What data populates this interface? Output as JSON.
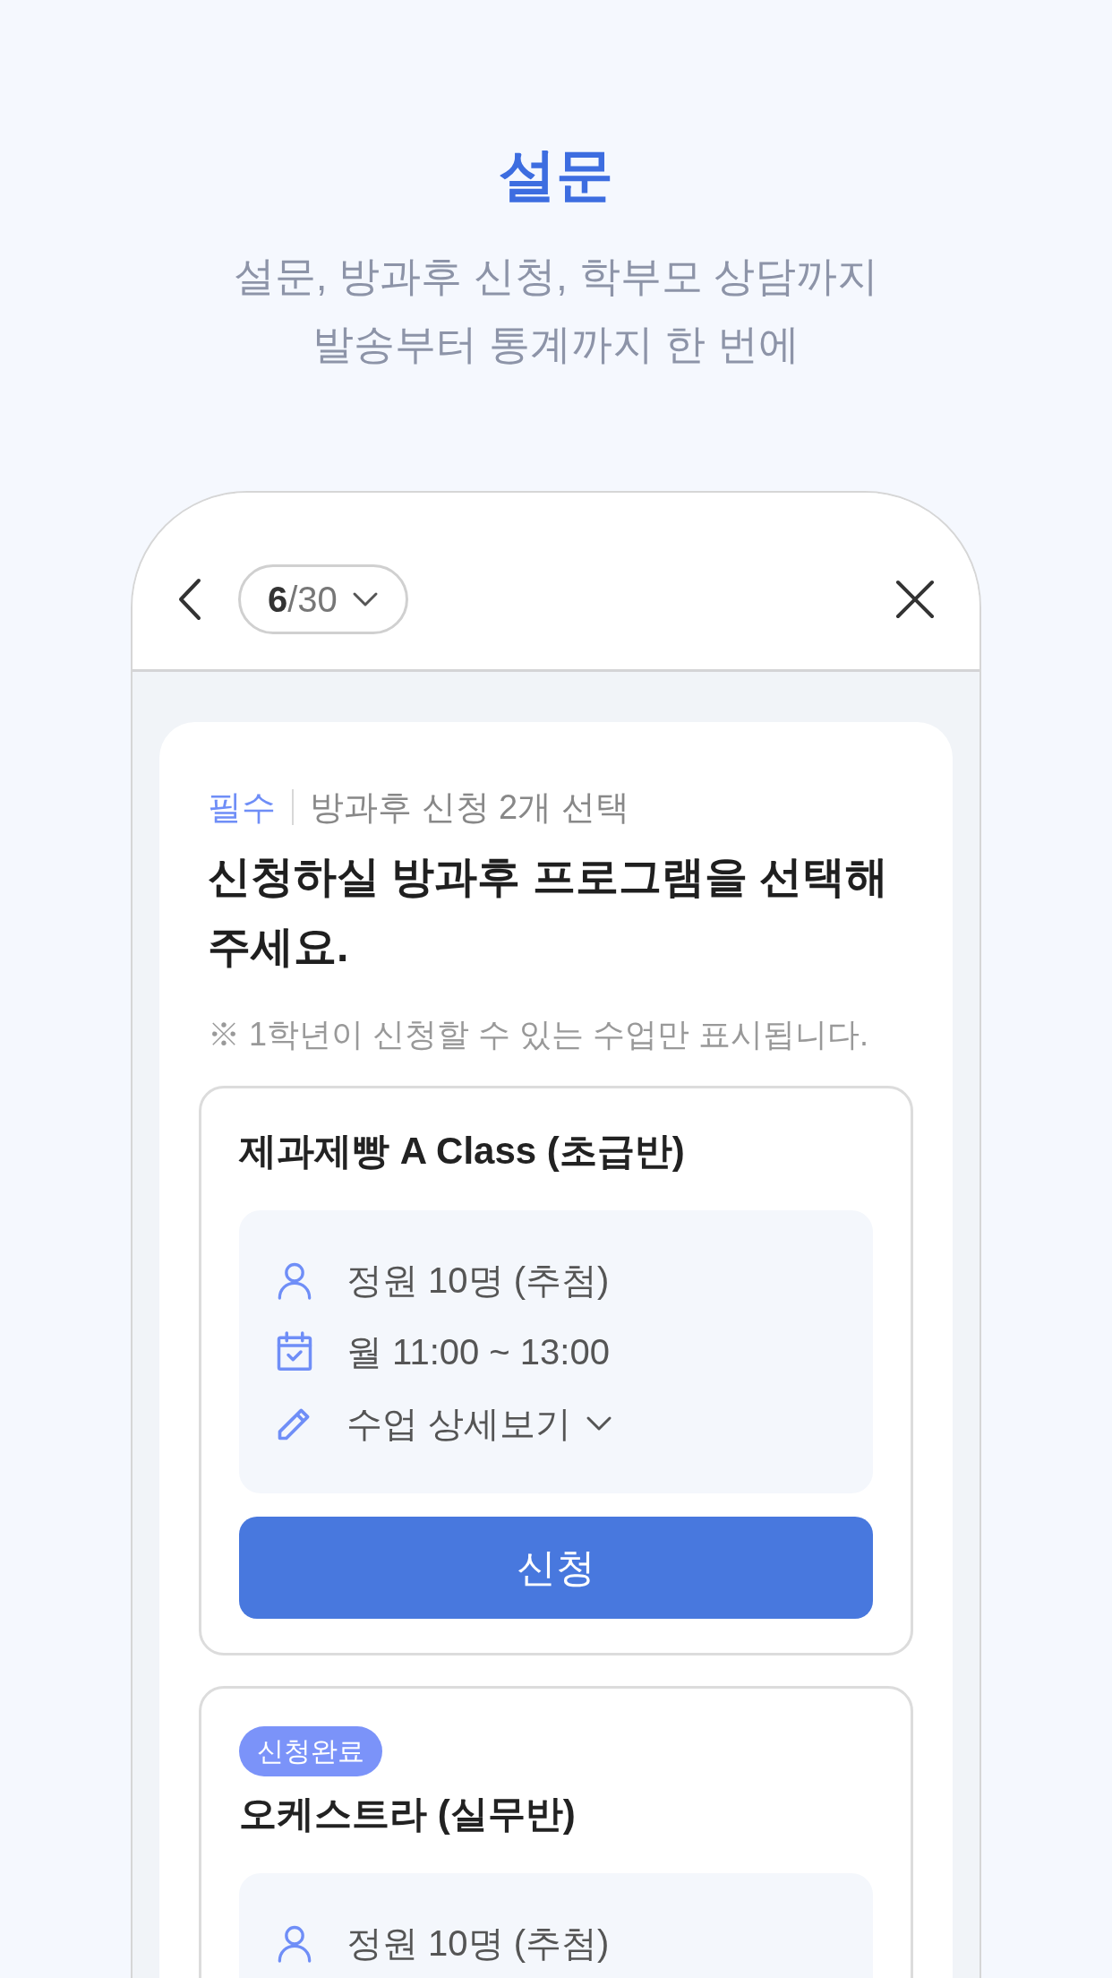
{
  "hero": {
    "title": "설문",
    "subtitle_lines": [
      "설문, 방과후 신청, 학부모 상담까지",
      "발송부터 통계까지 한 번에"
    ]
  },
  "header": {
    "current": "6",
    "total": "/30"
  },
  "question": {
    "required_label": "필수",
    "category": "방과후 신청 2개 선택",
    "title": "신청하실 방과후 프로그램을 선택해 주세요.",
    "note": "※ 1학년이 신청할 수 있는 수업만 표시됩니다."
  },
  "options": [
    {
      "name": "제과제빵 A Class (초급반)",
      "applied": false,
      "info": [
        {
          "kind": "capacity",
          "text": "정원 10명 (추첨)"
        },
        {
          "kind": "schedule",
          "text": "월 11:00 ~ 13:00"
        },
        {
          "kind": "details",
          "text": "수업 상세보기",
          "expanded": false
        }
      ],
      "button": "신청"
    },
    {
      "name": "오케스트라 (실무반)",
      "applied": true,
      "badge": "신청완료",
      "info": [
        {
          "kind": "capacity",
          "text": "정원 10명 (추첨)"
        }
      ]
    }
  ]
}
